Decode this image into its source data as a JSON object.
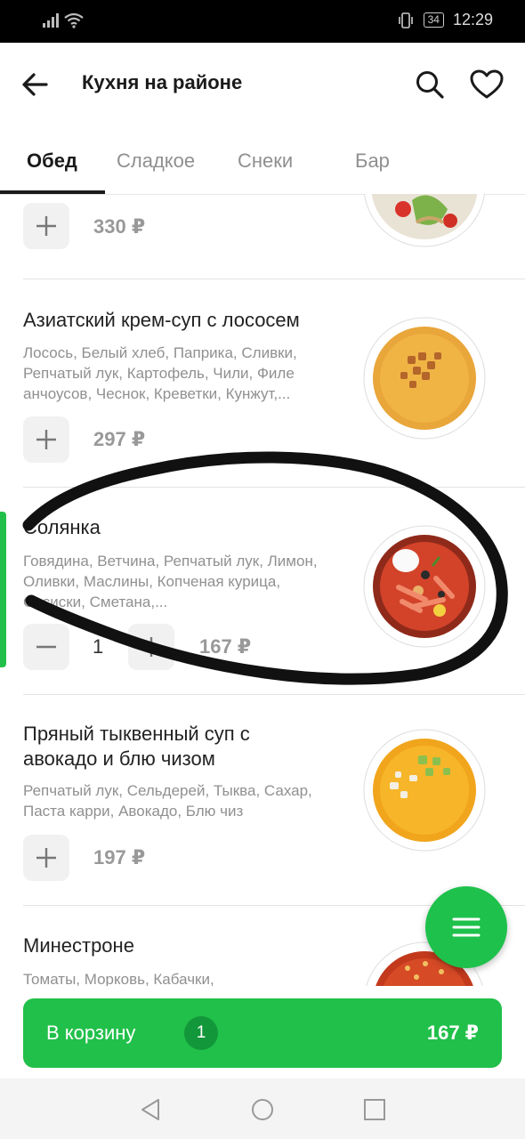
{
  "status_bar": {
    "time": "12:29",
    "battery": "34"
  },
  "header": {
    "title": "Кухня на районе"
  },
  "tabs": [
    {
      "label": "Обед",
      "active": true
    },
    {
      "label": "Сладкое",
      "active": false
    },
    {
      "label": "Снеки",
      "active": false
    },
    {
      "label": "Бар",
      "active": false
    }
  ],
  "items": [
    {
      "price": "330 ₽"
    },
    {
      "name": "Азиатский крем-суп с лососем",
      "desc": "Лосось, Белый хлеб, Паприка, Сливки, Репчатый лук, Картофель, Чили, Филе анчоусов, Чеснок, Креветки, Кунжут,...",
      "price": "297 ₽"
    },
    {
      "name": "Солянка",
      "desc": "Говядина, Ветчина, Репчатый лук, Лимон, Оливки, Маслины, Копченая курица, Сосиски, Сметана,...",
      "quantity": "1",
      "price": "167 ₽"
    },
    {
      "name": "Пряный тыквенный суп с авокадо и блю чизом",
      "desc": "Репчатый лук, Сельдерей, Тыква, Сахар, Паста карри, Авокадо, Блю чиз",
      "price": "197 ₽"
    },
    {
      "name": "Минестроне",
      "desc": "Томаты, Морковь, Кабачки,"
    }
  ],
  "cart": {
    "label": "В корзину",
    "count": "1",
    "total": "167 ₽"
  },
  "colors": {
    "accent": "#21c04a",
    "price": "#999999",
    "muted": "#909090"
  },
  "icons": [
    "back-arrow-icon",
    "search-icon",
    "heart-icon",
    "plus-icon",
    "minus-icon",
    "menu-icon",
    "nav-back-icon",
    "nav-home-icon",
    "nav-recents-icon"
  ]
}
